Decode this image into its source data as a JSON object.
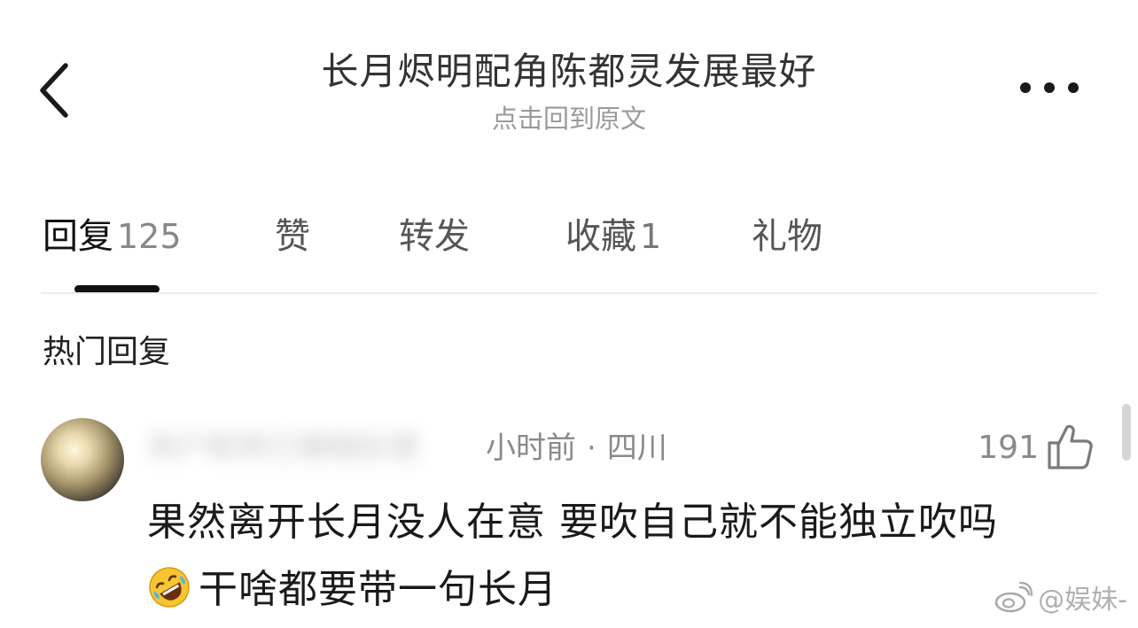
{
  "header": {
    "back_icon": "chevron-left-icon",
    "title": "长月烬明配角陈都灵发展最好",
    "subtitle": "点击回到原文",
    "more_icon": "more-horizontal-icon"
  },
  "tabs": [
    {
      "label": "回复",
      "count": "125",
      "active": true
    },
    {
      "label": "赞",
      "count": "",
      "active": false
    },
    {
      "label": "转发",
      "count": "",
      "active": false
    },
    {
      "label": "收藏",
      "count": "1",
      "active": false
    },
    {
      "label": "礼物",
      "count": "",
      "active": false
    }
  ],
  "section": {
    "title": "热门回复"
  },
  "comment": {
    "username": "用户昵称已模糊处理",
    "time": "小时前",
    "separator": "·",
    "location": "四川",
    "likes": "191",
    "like_icon": "thumbs-up-icon",
    "text_line1": "果然离开长月没人在意 要吹自己就不能独立吹吗",
    "emoji": "rolling-on-floor-laughing-icon",
    "text_line2": "干啥都要带一句长月"
  },
  "watermark": {
    "icon": "weibo-logo-icon",
    "text": "@娱妹-"
  },
  "colors": {
    "title_text": "#333333",
    "subtitle_text": "#9a9a9a",
    "active_tab_indicator": "#111111",
    "meta_text": "#8a8a8a",
    "body_text": "#1a1a1a",
    "divider": "#ececec"
  }
}
